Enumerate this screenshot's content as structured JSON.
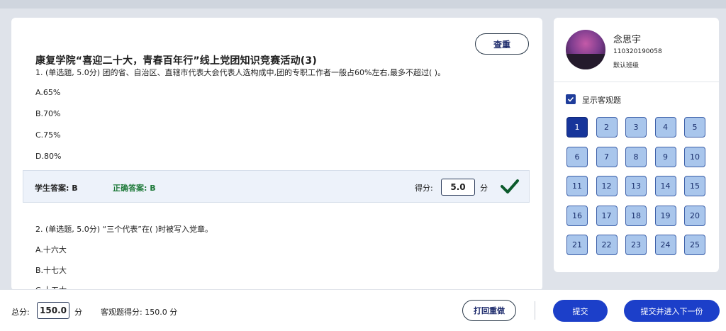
{
  "quiz": {
    "title": "康复学院“喜迎二十大，青春百年行”线上党团知识竞赛活动(3)",
    "view_button": "查重",
    "questions": [
      {
        "text": "1. (单选题, 5.0分) 团的省、自治区、直辖市代表大会代表人选构成中,团的专职工作者一般占60%左右,最多不超过( )。",
        "options": [
          "A.65%",
          "B.70%",
          "C.75%",
          "D.80%"
        ],
        "student_answer_label": "学生答案: B",
        "correct_answer_label": "正确答案: B",
        "score_label": "得分:",
        "score_value": "5.0",
        "score_unit": "分"
      },
      {
        "text": "2. (单选题, 5.0分) “三个代表”在( )时被写入党章。",
        "options": [
          "A.十六大",
          "B.十七大",
          "C.十五大"
        ]
      }
    ]
  },
  "student": {
    "name": "念思宇",
    "id": "110320190058",
    "class": "默认班级"
  },
  "sidebar": {
    "show_objective_label": "显示客观题",
    "show_objective_checked": true,
    "question_numbers": [
      "1",
      "2",
      "3",
      "4",
      "5",
      "6",
      "7",
      "8",
      "9",
      "10",
      "11",
      "12",
      "13",
      "14",
      "15",
      "16",
      "17",
      "18",
      "19",
      "20",
      "21",
      "22",
      "23",
      "24",
      "25"
    ],
    "active_question": "1"
  },
  "footer": {
    "total_label": "总分:",
    "total_value": "150.0",
    "total_unit": "分",
    "objective_score": "客观题得分: 150.0 分",
    "redo_button": "打回重做",
    "submit_button": "提交",
    "submit_next_button": "提交并进入下一份"
  },
  "colors": {
    "primary": "#1c3fc9",
    "number_fill": "#a9c6ec",
    "active_number": "#17359a",
    "correct_green": "#1f7a3a",
    "check_icon": "#0c5a2c"
  }
}
